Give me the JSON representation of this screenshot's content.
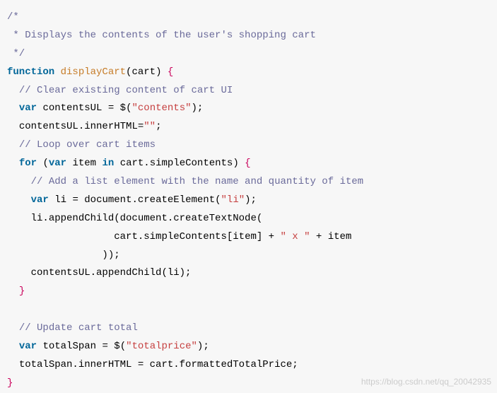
{
  "code": {
    "comment_block_open": "/*",
    "comment_block_line": " * Displays the contents of the user's shopping cart",
    "comment_block_close": " */",
    "kw_function": "function",
    "fn_name": "displayCart",
    "paren_open": "(",
    "param_cart": "cart",
    "paren_close": ")",
    "space": " ",
    "brace_open": "{",
    "brace_close": "}",
    "cmt_clear": "// Clear existing content of cart UI",
    "kw_var": "var",
    "id_contentsUL": "contentsUL",
    "eq": " = ",
    "dollar": "$",
    "str_contents": "\"contents\"",
    "semi": ";",
    "stmt_clear_inner": "contentsUL.innerHTML=",
    "str_empty": "\"\"",
    "cmt_loop": "// Loop over cart items",
    "kw_for": "for",
    "kw_in": "in",
    "id_item": "item",
    "id_cart_simpleContents": "cart.simpleContents",
    "cmt_addli": "// Add a list element with the name and quantity of item",
    "id_li": "li",
    "id_document_createElement": "document.createElement",
    "str_li": "\"li\"",
    "stmt_li_append_open": "li.appendChild(document.createTextNode(",
    "expr_cart_index": "cart.simpleContents[item] + ",
    "str_x": "\" x \"",
    "plus_item": " + item",
    "close_paren2": "));",
    "stmt_contents_append": "contentsUL.appendChild(li);",
    "cmt_update": "// Update cart total",
    "id_totalSpan": "totalSpan",
    "str_totalprice": "\"totalprice\"",
    "stmt_total_assign": "totalSpan.innerHTML = cart.formattedTotalPrice;"
  },
  "watermark": "https://blog.csdn.net/qq_20042935"
}
